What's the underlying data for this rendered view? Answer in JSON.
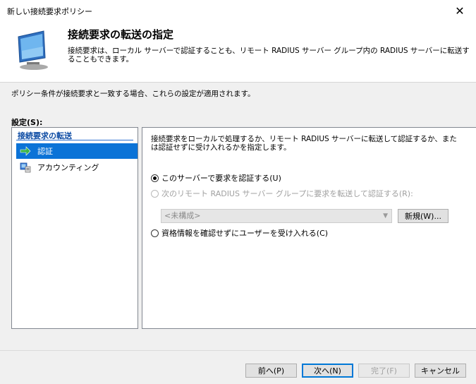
{
  "window": {
    "title": "新しい接続要求ポリシー"
  },
  "header": {
    "title": "接続要求の転送の指定",
    "description": "接続要求は、ローカル サーバーで認証することも、リモート RADIUS サーバー グループ内の RADIUS サーバーに転送することもできます。",
    "icon": "monitor-icon"
  },
  "policy_note": "ポリシー条件が接続要求と一致する場合、これらの設定が適用されます。",
  "settings_label": "設定(S):",
  "sidebar": {
    "heading": "接続要求の転送",
    "items": [
      {
        "label": "認証",
        "icon": "green-arrow-icon",
        "selected": true
      },
      {
        "label": "アカウンティング",
        "icon": "accounting-icon",
        "selected": false
      }
    ]
  },
  "content": {
    "description": "接続要求をローカルで処理するか、リモート RADIUS サーバーに転送して認証するか、または認証せずに受け入れるかを指定します。",
    "options": [
      {
        "label": "このサーバーで要求を認証する(U)",
        "checked": true,
        "disabled": false
      },
      {
        "label": "次のリモート RADIUS サーバー グループに要求を転送して認証する(R):",
        "checked": false,
        "disabled": true
      },
      {
        "label": "資格情報を確認せずにユーザーを受け入れる(C)",
        "checked": false,
        "disabled": false
      }
    ],
    "group_select_value": "<未構成>",
    "new_button": "新規(W)..."
  },
  "footer": {
    "back": "前へ(P)",
    "next": "次へ(N)",
    "finish": "完了(F)",
    "cancel": "キャンセル"
  },
  "colors": {
    "selection": "#0b73d7",
    "heading": "#0b4aa3",
    "accent": "#0078d7"
  }
}
